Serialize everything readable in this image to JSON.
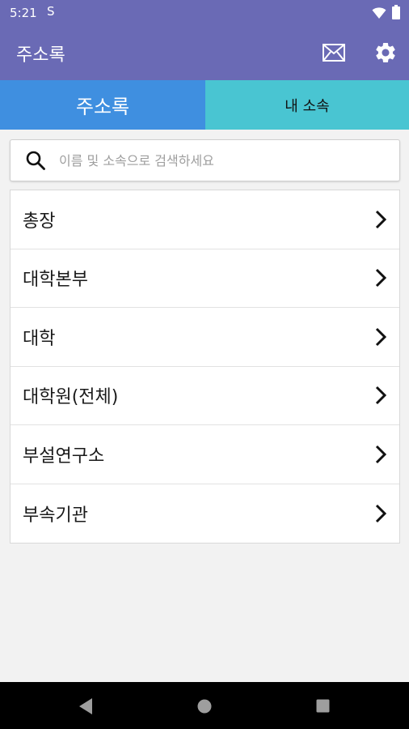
{
  "status_bar": {
    "time": "5:21",
    "sync_glyph": "S",
    "wifi_icon": "wifi-icon",
    "battery_icon": "battery-icon"
  },
  "app_bar": {
    "title": "주소록",
    "mail_icon": "mail-icon",
    "settings_icon": "gear-icon"
  },
  "tabs": [
    {
      "label": "주소록",
      "active": true
    },
    {
      "label": "내 소속",
      "active": false
    }
  ],
  "search": {
    "value": "",
    "placeholder": "이름 및 소속으로 검색하세요",
    "icon": "search-icon"
  },
  "list": {
    "items": [
      {
        "label": "총장"
      },
      {
        "label": "대학본부"
      },
      {
        "label": "대학"
      },
      {
        "label": "대학원(전체)"
      },
      {
        "label": "부설연구소"
      },
      {
        "label": "부속기관"
      }
    ]
  },
  "nav_bar": {
    "back_icon": "back-icon",
    "home_icon": "home-icon",
    "recents_icon": "recents-icon"
  },
  "colors": {
    "app_bar": "#6a6ab5",
    "tab_active": "#3f8fe0",
    "tab_inactive": "#49c5d2",
    "background": "#f2f2f2"
  }
}
